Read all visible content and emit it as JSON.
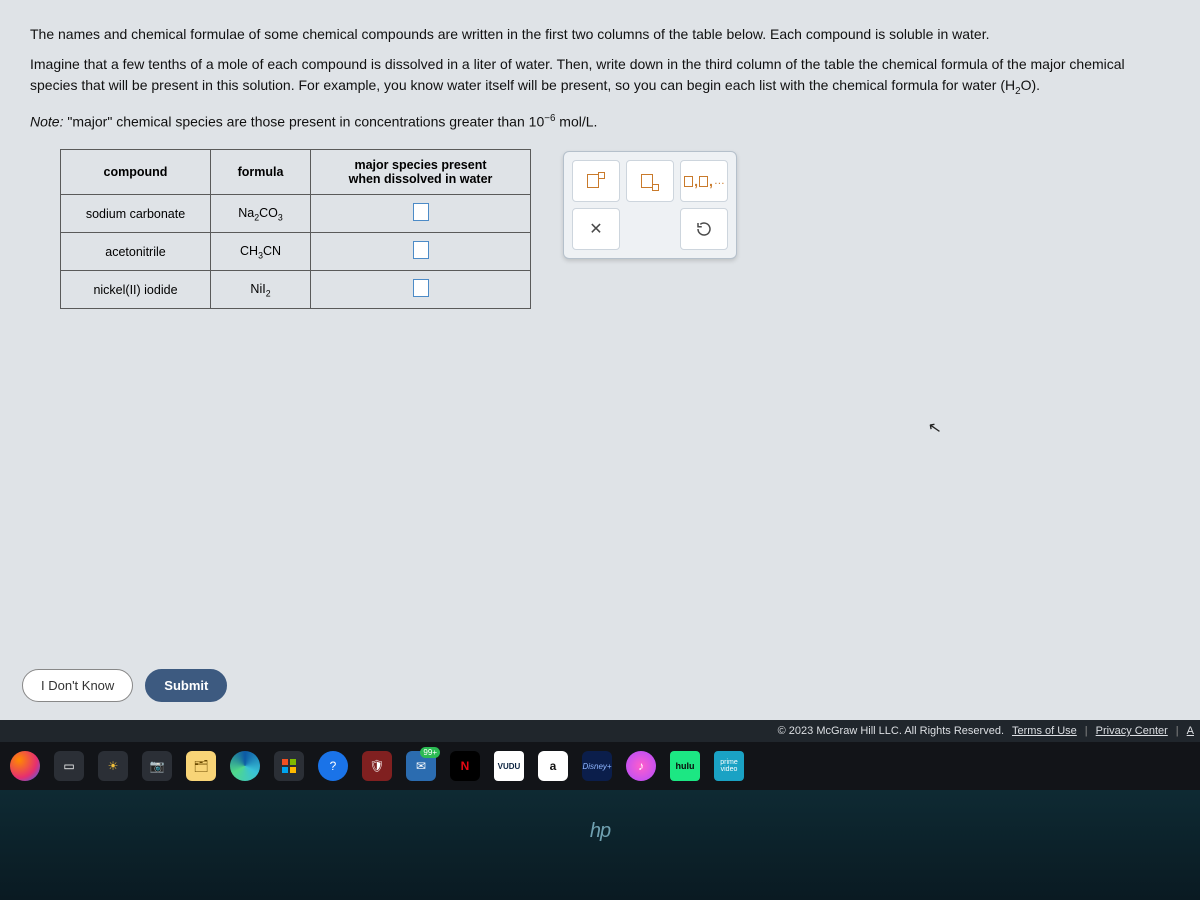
{
  "question": {
    "para1": "The names and chemical formulae of some chemical compounds are written in the first two columns of the table below. Each compound is soluble in water.",
    "para2_a": "Imagine that a few tenths of a mole of each compound is dissolved in a liter of water. Then, write down in the third column of the table the chemical formula of the major chemical species that will be present in this solution. For example, you know water itself will be present, so you can begin each list with the chemical formula for water ",
    "para2_formula_base": "(H",
    "para2_formula_sub": "2",
    "para2_formula_end": "O).",
    "note_prefix": "Note:",
    "note_body_a": " \"major\" chemical species are those present in concentrations greater than ",
    "note_base": "10",
    "note_exp": "−6",
    "note_body_b": " mol/L."
  },
  "table": {
    "headers": {
      "compound": "compound",
      "formula": "formula",
      "species": "major species present\nwhen dissolved in water"
    },
    "rows": [
      {
        "compound": "sodium carbonate",
        "formula_pre": "Na",
        "formula_sub1": "2",
        "formula_mid": "CO",
        "formula_sub2": "3"
      },
      {
        "compound": "acetonitrile",
        "formula_pre": "CH",
        "formula_sub1": "3",
        "formula_mid": "CN",
        "formula_sub2": ""
      },
      {
        "compound": "nickel(II) iodide",
        "formula_pre": "NiI",
        "formula_sub1": "2",
        "formula_mid": "",
        "formula_sub2": ""
      }
    ]
  },
  "toolbox": {
    "superscript": "superscript",
    "subscript": "subscript",
    "list": "list",
    "clear": "clear",
    "reset": "reset",
    "list_text": ",…"
  },
  "buttons": {
    "idk": "I Don't Know",
    "submit": "Submit"
  },
  "footer": {
    "copyright": "© 2023 McGraw Hill LLC. All Rights Reserved.",
    "terms": "Terms of Use",
    "privacy": "Privacy Center",
    "access": "A"
  },
  "taskbar": {
    "mail_badge": "99+",
    "netflix": "N",
    "vudu": "VUDU",
    "amazon": "a",
    "disney": "Disney+",
    "hulu": "hulu",
    "prime": "prime video"
  },
  "desktop": {
    "hp": "hp"
  }
}
